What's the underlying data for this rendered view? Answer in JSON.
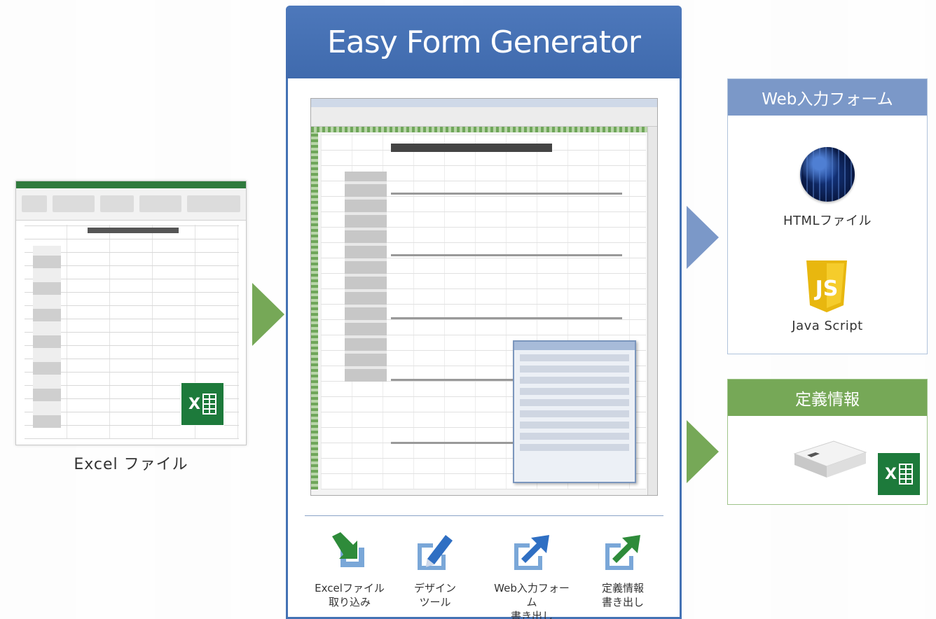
{
  "source": {
    "label": "Excel ファイル"
  },
  "center": {
    "title": "Easy Form Generator",
    "features": [
      {
        "icon": "import-arrow-icon",
        "line1": "Excelファイル",
        "line2": "取り込み"
      },
      {
        "icon": "pencil-edit-icon",
        "line1": "デザイン",
        "line2": "ツール"
      },
      {
        "icon": "export-arrow-icon",
        "line1": "Web入力フォーム",
        "line2": "書き出し"
      },
      {
        "icon": "export-arrow-icon",
        "line1": "定義情報",
        "line2": "書き出し"
      }
    ]
  },
  "outputs": {
    "web": {
      "header": "Web入力フォーム",
      "html_label": "HTMLファイル",
      "js_label": "Java Script",
      "js_badge": "JS"
    },
    "definition": {
      "header": "定義情報"
    }
  },
  "colors": {
    "center_blue": "#4472b4",
    "arrow_green": "#76a857",
    "arrow_blue": "#7b98c8",
    "excel_green": "#1d7a3b",
    "js_yellow": "#f0c419",
    "import_green": "#2e8b3a",
    "export_blue": "#2f6fc3"
  }
}
